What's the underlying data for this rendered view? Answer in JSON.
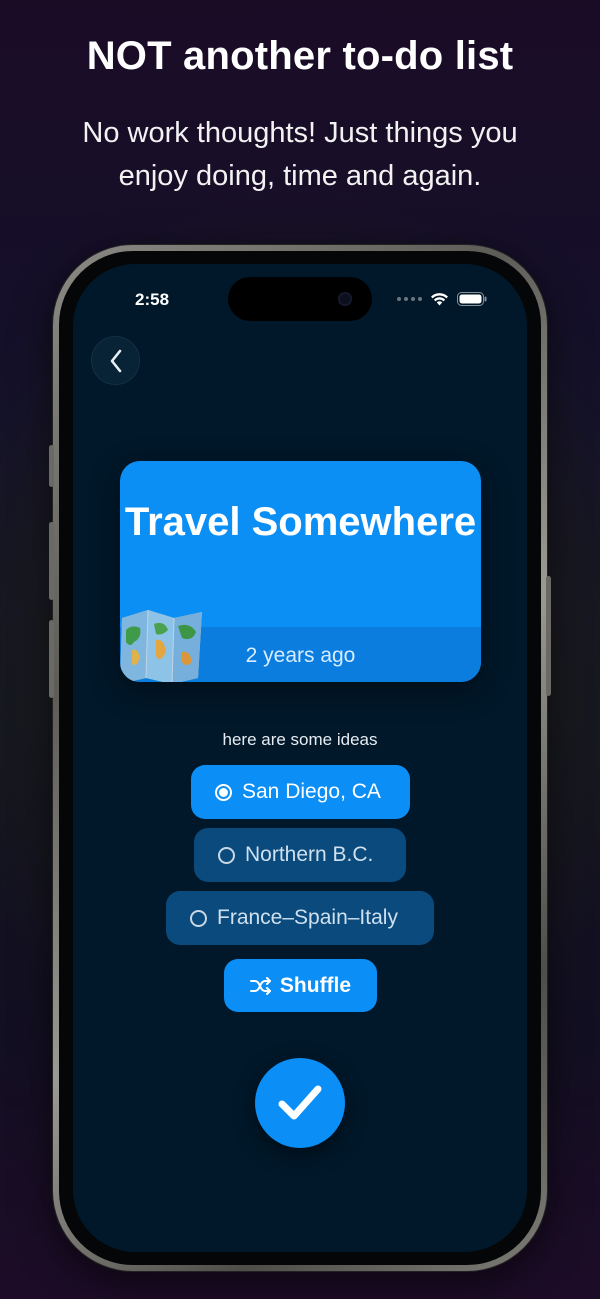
{
  "promo": {
    "headline": "NOT another to-do list",
    "subline": "No work thoughts! Just things you enjoy doing, time and again."
  },
  "status_bar": {
    "time": "2:58",
    "icons": [
      "signal-dots-icon",
      "wifi-icon",
      "battery-icon"
    ]
  },
  "nav": {
    "back_icon": "chevron-left-icon"
  },
  "card": {
    "title": "Travel Somewhere",
    "elapsed": "2 years ago",
    "image": "world-map-icon",
    "color": "#0c8ff5"
  },
  "ideas": {
    "label": "here are some ideas",
    "options": [
      {
        "label": "San Diego, CA",
        "selected": true
      },
      {
        "label": "Northern B.C.",
        "selected": false
      },
      {
        "label": "France–Spain–Italy",
        "selected": false
      }
    ],
    "shuffle_label": "Shuffle",
    "shuffle_icon": "shuffle-icon"
  },
  "done_button": {
    "icon": "checkmark-icon",
    "color": "#0b8ef5"
  }
}
